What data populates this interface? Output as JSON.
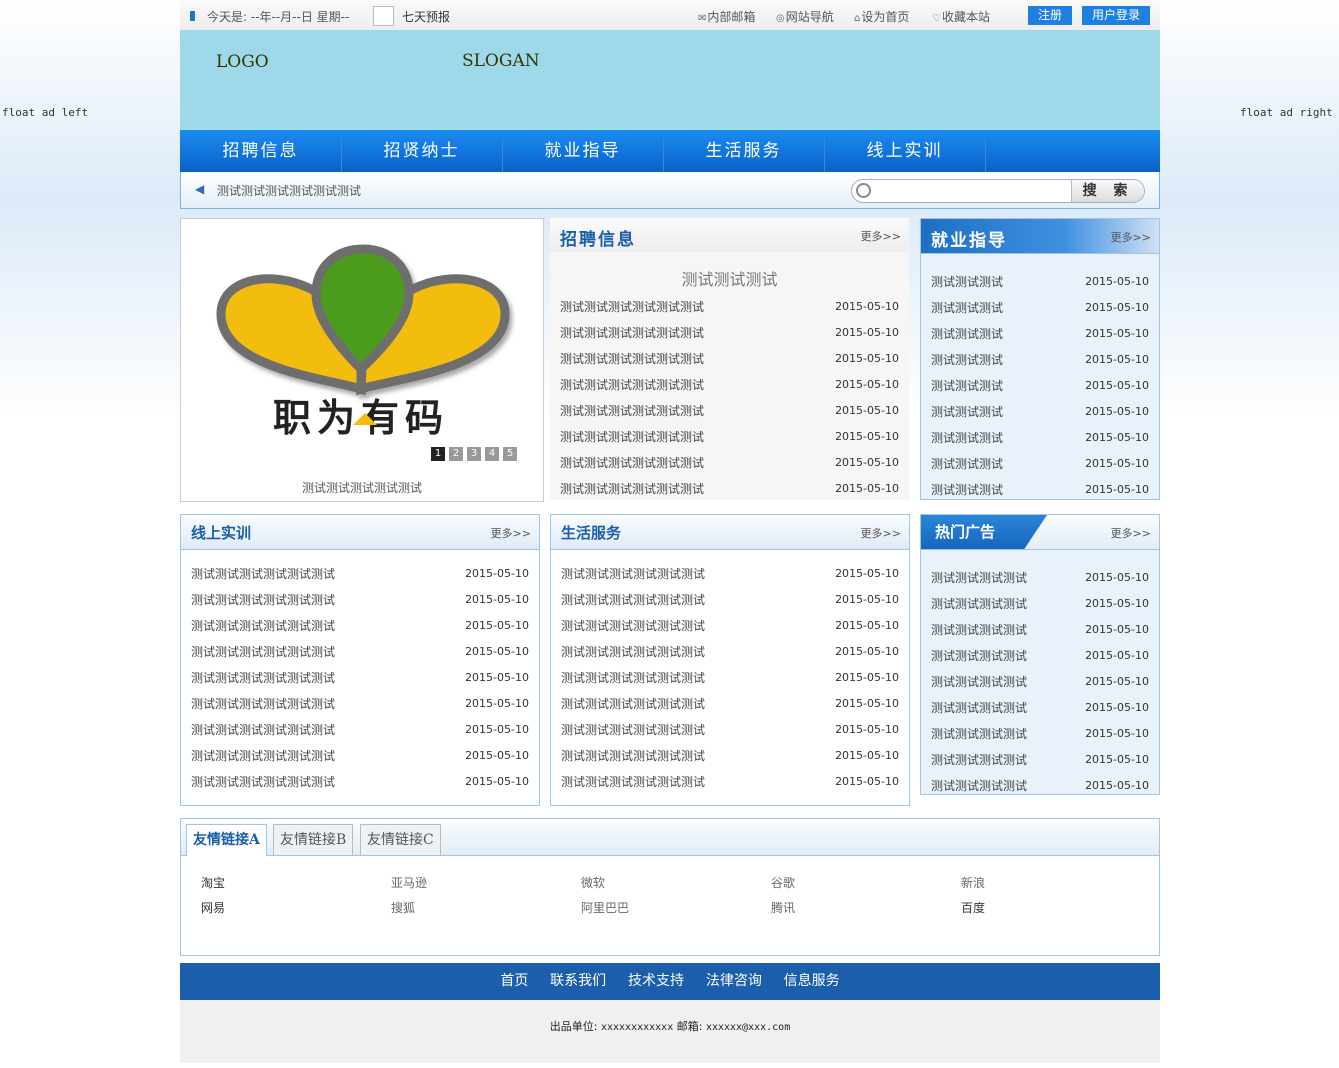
{
  "float_ads": {
    "left": "float ad left",
    "right": "float ad right"
  },
  "topbar": {
    "date": "今天是: --年--月--日 星期--",
    "weather_link": "七天预报",
    "links": [
      {
        "label": "内部邮箱",
        "icon": "mail-icon"
      },
      {
        "label": "网站导航",
        "icon": "globe-icon"
      },
      {
        "label": "设为首页",
        "icon": "home-icon"
      },
      {
        "label": "收藏本站",
        "icon": "bookmark-icon"
      }
    ],
    "register": "注册",
    "login": "用户登录"
  },
  "header": {
    "logo": "LOGO",
    "slogan": "SLOGAN"
  },
  "nav": [
    "招聘信息",
    "招贤纳士",
    "就业指导",
    "生活服务",
    "线上实训"
  ],
  "notice": {
    "text": "测试测试测试测试测试测试",
    "search_button": "搜 索",
    "search_placeholder": ""
  },
  "slider": {
    "brand_text": "职为有码",
    "caption": "测试测试测试测试测试",
    "pages": [
      "1",
      "2",
      "3",
      "4",
      "5"
    ],
    "active_page": 1
  },
  "recruit": {
    "title": "招聘信息",
    "more": "更多>>",
    "featured": "测试测试测试",
    "items": [
      {
        "title": "测试测试测试测试测试测试",
        "date": "2015-05-10"
      },
      {
        "title": "测试测试测试测试测试测试",
        "date": "2015-05-10"
      },
      {
        "title": "测试测试测试测试测试测试",
        "date": "2015-05-10"
      },
      {
        "title": "测试测试测试测试测试测试",
        "date": "2015-05-10"
      },
      {
        "title": "测试测试测试测试测试测试",
        "date": "2015-05-10"
      },
      {
        "title": "测试测试测试测试测试测试",
        "date": "2015-05-10"
      },
      {
        "title": "测试测试测试测试测试测试",
        "date": "2015-05-10"
      },
      {
        "title": "测试测试测试测试测试测试",
        "date": "2015-05-10"
      }
    ]
  },
  "guide": {
    "title": "就业指导",
    "more": "更多>>",
    "items": [
      {
        "title": "测试测试测试",
        "date": "2015-05-10"
      },
      {
        "title": "测试测试测试",
        "date": "2015-05-10"
      },
      {
        "title": "测试测试测试",
        "date": "2015-05-10"
      },
      {
        "title": "测试测试测试",
        "date": "2015-05-10"
      },
      {
        "title": "测试测试测试",
        "date": "2015-05-10"
      },
      {
        "title": "测试测试测试",
        "date": "2015-05-10"
      },
      {
        "title": "测试测试测试",
        "date": "2015-05-10"
      },
      {
        "title": "测试测试测试",
        "date": "2015-05-10"
      },
      {
        "title": "测试测试测试",
        "date": "2015-05-10"
      }
    ]
  },
  "training": {
    "title": "线上实训",
    "more": "更多>>",
    "items": [
      {
        "title": "测试测试测试测试测试测试",
        "date": "2015-05-10"
      },
      {
        "title": "测试测试测试测试测试测试",
        "date": "2015-05-10"
      },
      {
        "title": "测试测试测试测试测试测试",
        "date": "2015-05-10"
      },
      {
        "title": "测试测试测试测试测试测试",
        "date": "2015-05-10"
      },
      {
        "title": "测试测试测试测试测试测试",
        "date": "2015-05-10"
      },
      {
        "title": "测试测试测试测试测试测试",
        "date": "2015-05-10"
      },
      {
        "title": "测试测试测试测试测试测试",
        "date": "2015-05-10"
      },
      {
        "title": "测试测试测试测试测试测试",
        "date": "2015-05-10"
      },
      {
        "title": "测试测试测试测试测试测试",
        "date": "2015-05-10"
      }
    ]
  },
  "life": {
    "title": "生活服务",
    "more": "更多>>",
    "items": [
      {
        "title": "测试测试测试测试测试测试",
        "date": "2015-05-10"
      },
      {
        "title": "测试测试测试测试测试测试",
        "date": "2015-05-10"
      },
      {
        "title": "测试测试测试测试测试测试",
        "date": "2015-05-10"
      },
      {
        "title": "测试测试测试测试测试测试",
        "date": "2015-05-10"
      },
      {
        "title": "测试测试测试测试测试测试",
        "date": "2015-05-10"
      },
      {
        "title": "测试测试测试测试测试测试",
        "date": "2015-05-10"
      },
      {
        "title": "测试测试测试测试测试测试",
        "date": "2015-05-10"
      },
      {
        "title": "测试测试测试测试测试测试",
        "date": "2015-05-10"
      },
      {
        "title": "测试测试测试测试测试测试",
        "date": "2015-05-10"
      }
    ]
  },
  "ads": {
    "title": "热门广告",
    "more": "更多>>",
    "items": [
      {
        "title": "测试测试测试测试",
        "date": "2015-05-10"
      },
      {
        "title": "测试测试测试测试",
        "date": "2015-05-10"
      },
      {
        "title": "测试测试测试测试",
        "date": "2015-05-10"
      },
      {
        "title": "测试测试测试测试",
        "date": "2015-05-10"
      },
      {
        "title": "测试测试测试测试",
        "date": "2015-05-10"
      },
      {
        "title": "测试测试测试测试",
        "date": "2015-05-10"
      },
      {
        "title": "测试测试测试测试",
        "date": "2015-05-10"
      },
      {
        "title": "测试测试测试测试",
        "date": "2015-05-10"
      },
      {
        "title": "测试测试测试测试",
        "date": "2015-05-10"
      }
    ]
  },
  "friend_links": {
    "tabs": [
      "友情链接A",
      "友情链接B",
      "友情链接C"
    ],
    "active_tab": 0,
    "rows": [
      [
        "淘宝",
        "亚马逊",
        "微软",
        "谷歌",
        "新浪"
      ],
      [
        "网易",
        "搜狐",
        "阿里巴巴",
        "腾讯",
        "百度"
      ]
    ]
  },
  "footer": {
    "nav": [
      "首页",
      "联系我们",
      "技术支持",
      "法律咨询",
      "信息服务"
    ],
    "publisher_label": "出品单位:",
    "publisher": "xxxxxxxxxxxx",
    "email_label": "邮箱:",
    "email": "xxxxxx@xxx.com"
  },
  "colors": {
    "nav": "#0a6fd6",
    "header": "#9ed9ea",
    "footer": "#1b5fac",
    "accent": "#1b5fa8"
  }
}
